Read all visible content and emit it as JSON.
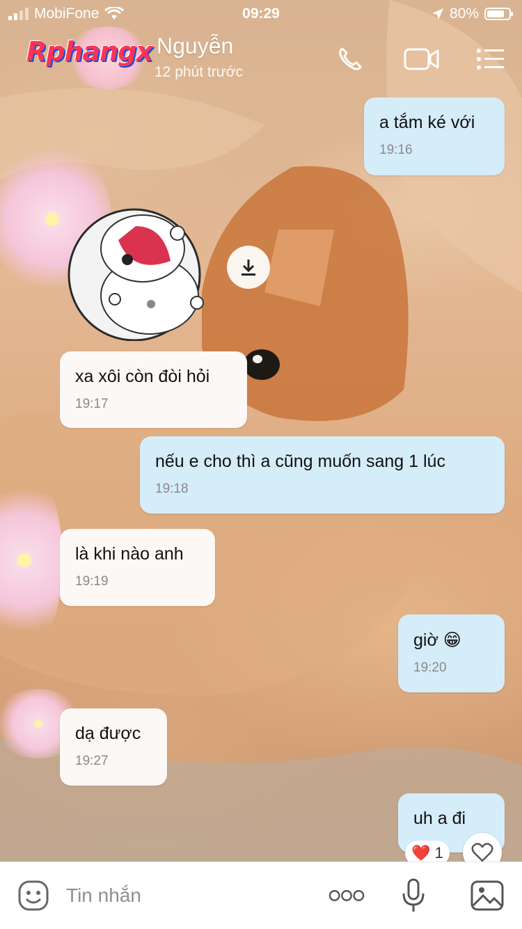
{
  "status_bar": {
    "carrier": "MobiFone",
    "time": "09:29",
    "battery": "80%",
    "battery_level": 0.8
  },
  "header": {
    "logo": "Rphangx",
    "contact_name": "Nguyễn",
    "last_seen": "12 phút trước",
    "icons": [
      "phone-icon",
      "video-call-icon",
      "menu-icon"
    ]
  },
  "messages": [
    {
      "side": "out",
      "text": "a tắm ké với",
      "time": "19:16"
    },
    {
      "side": "in",
      "type": "sticker",
      "sticker": "white-cat-sticker"
    },
    {
      "side": "in",
      "text": "xa xôi còn đòi hỏi",
      "time": "19:17"
    },
    {
      "side": "out",
      "text": "nếu e cho thì a cũng muốn sang 1 lúc",
      "time": "19:18"
    },
    {
      "side": "in",
      "text": "là khi nào anh",
      "time": "19:19"
    },
    {
      "side": "out",
      "text": "giờ 😁",
      "time": "19:20"
    },
    {
      "side": "in",
      "text": "dạ được",
      "time": "19:27"
    },
    {
      "side": "out",
      "text": "uh a đi",
      "time": ""
    }
  ],
  "reaction": {
    "emoji": "❤️",
    "count": "1"
  },
  "composer": {
    "placeholder": "Tin nhắn",
    "icons": [
      "sticker-icon",
      "more-icon",
      "microphone-icon",
      "image-icon"
    ]
  },
  "colors": {
    "incoming_bubble": "#fbf8f5",
    "outgoing_bubble": "#d5ecf9",
    "time_text": "#8a8a8a",
    "heart": "#e8304a"
  }
}
